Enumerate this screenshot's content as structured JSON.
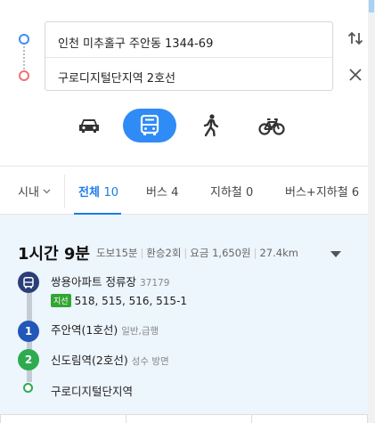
{
  "route": {
    "origin": "인천 미추홀구 주안동 1344-69",
    "destination": "구로디지털단지역 2호선"
  },
  "modes": [
    {
      "name": "car",
      "icon": "car-icon",
      "active": false
    },
    {
      "name": "transit",
      "icon": "bus-icon",
      "active": true
    },
    {
      "name": "walk",
      "icon": "walk-icon",
      "active": false
    },
    {
      "name": "bike",
      "icon": "bike-icon",
      "active": false
    }
  ],
  "filters": {
    "region": "시내",
    "tabs": [
      {
        "label": "전체",
        "count": "10"
      },
      {
        "label": "버스",
        "count": "4"
      },
      {
        "label": "지하철",
        "count": "0"
      },
      {
        "label": "버스+지하철",
        "count": "6"
      }
    ]
  },
  "result": {
    "duration": "1시간 9분",
    "walk": "도보15분",
    "transfers": "환승2회",
    "fare": "요금 1,650원",
    "distance": "27.4km",
    "steps": {
      "bus_stop": "쌍용아파트 정류장",
      "bus_stop_id": "37179",
      "bus_badge": "지선",
      "bus_numbers": "518, 515, 516, 515-1",
      "subway1_num": "1",
      "subway1_station": "주안역(1호선)",
      "subway1_type": "일반,급행",
      "subway2_num": "2",
      "subway2_station": "신도림역(2호선)",
      "subway2_dir": "성수 방면",
      "destination": "구로디지털단지역"
    }
  },
  "colors": {
    "accent": "#1a7de8",
    "transit_active": "#2f8bf5",
    "bus": "#2b3e7a",
    "line1": "#2256b8",
    "line2": "#2eab4f",
    "result_bg": "#edf5fd"
  }
}
